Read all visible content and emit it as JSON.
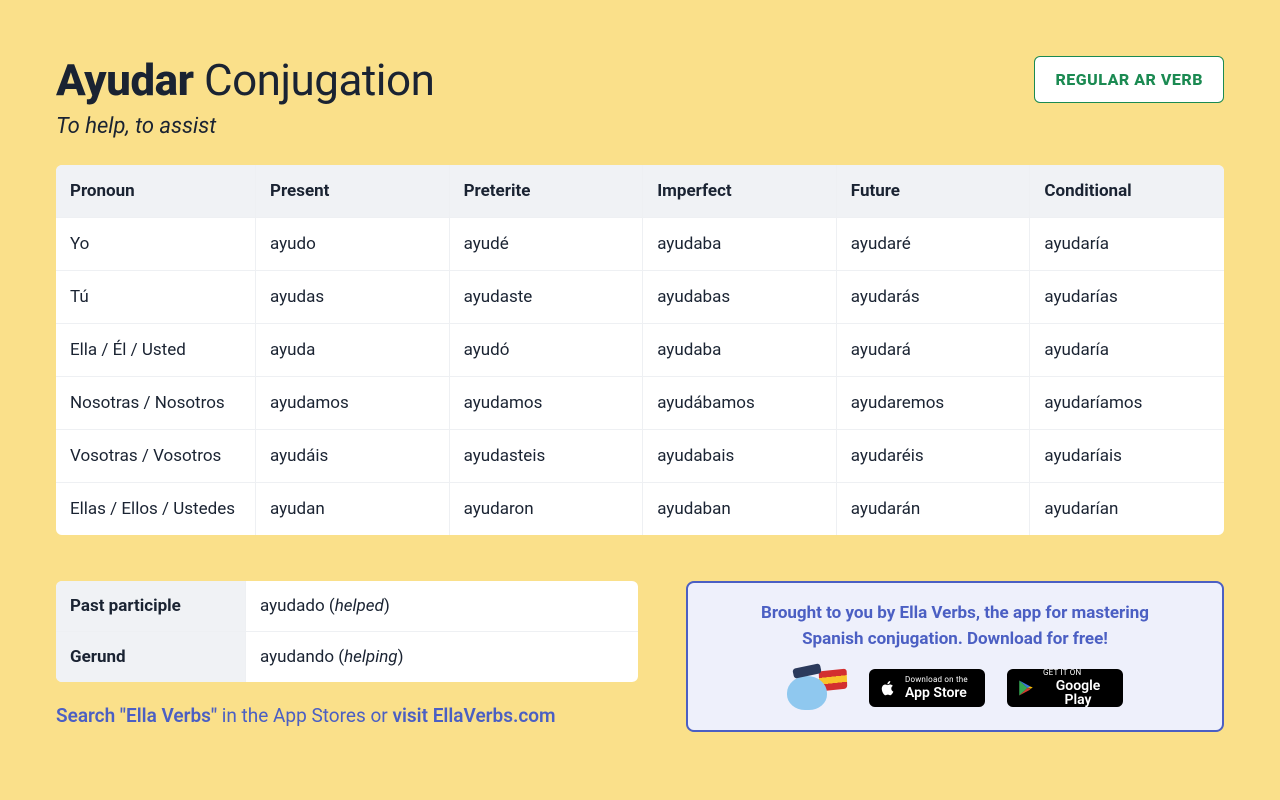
{
  "header": {
    "title_bold": "Ayudar",
    "title_rest": "Conjugation",
    "subtitle": "To help, to assist",
    "badge": "REGULAR AR VERB"
  },
  "table": {
    "headers": [
      "Pronoun",
      "Present",
      "Preterite",
      "Imperfect",
      "Future",
      "Conditional"
    ],
    "rows": [
      [
        "Yo",
        "ayudo",
        "ayudé",
        "ayudaba",
        "ayudaré",
        "ayudaría"
      ],
      [
        "Tú",
        "ayudas",
        "ayudaste",
        "ayudabas",
        "ayudarás",
        "ayudarías"
      ],
      [
        "Ella / Él / Usted",
        "ayuda",
        "ayudó",
        "ayudaba",
        "ayudará",
        "ayudaría"
      ],
      [
        "Nosotras / Nosotros",
        "ayudamos",
        "ayudamos",
        "ayudábamos",
        "ayudaremos",
        "ayudaríamos"
      ],
      [
        "Vosotras / Vosotros",
        "ayudáis",
        "ayudasteis",
        "ayudabais",
        "ayudaréis",
        "ayudaríais"
      ],
      [
        "Ellas / Ellos / Ustedes",
        "ayudan",
        "ayudaron",
        "ayudaban",
        "ayudarán",
        "ayudarían"
      ]
    ]
  },
  "mini": {
    "rows": [
      {
        "label": "Past participle",
        "value": "ayudado",
        "gloss": "helped"
      },
      {
        "label": "Gerund",
        "value": "ayudando",
        "gloss": "helping"
      }
    ]
  },
  "promo": {
    "line1": "Brought to you by Ella Verbs, the app for mastering",
    "line2": "Spanish conjugation. Download for free!",
    "apple_small": "Download on the",
    "apple_big": "App Store",
    "google_small": "GET IT ON",
    "google_big": "Google Play"
  },
  "footer": {
    "a": "Search \"Ella Verbs\"",
    "b": " in the App Stores or ",
    "c": "visit EllaVerbs.com"
  }
}
